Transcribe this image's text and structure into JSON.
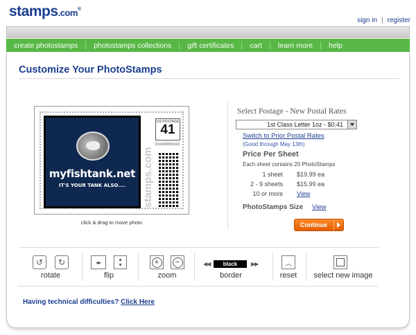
{
  "brand": {
    "name": "stamps",
    "suffix": ".com"
  },
  "top_links": {
    "sign_in": "sign in",
    "separator": "|",
    "register": "register"
  },
  "nav": {
    "items": [
      "create photostamps",
      "photostamps collections",
      "gift certificates",
      "cart",
      "learn more",
      "help"
    ]
  },
  "page": {
    "title": "Customize Your PhotoStamps"
  },
  "stamp_preview": {
    "photo_title": "myfishtank.net",
    "photo_subtitle": "IT'S YOUR TANK ALSO....",
    "postage_label": "US POSTAGE",
    "postage_value": "41",
    "serial": "1010000000103",
    "brand_vertical": "stamps.com",
    "caption": "click & drag to move photo"
  },
  "postage": {
    "heading": "Select Postage - New Postal Rates",
    "selected_rate": "1st Class Letter 1oz - $0.41",
    "prior_rates_link": "Switch to Prior Postal Rates",
    "good_through": "(Good through May 13th)",
    "price_heading": "Price Per Sheet",
    "sheet_note": "Each sheet contains 20 PhotoStamps",
    "prices": [
      {
        "qty": "1 sheet",
        "price": "$19.99 ea"
      },
      {
        "qty": "2 - 9 sheets",
        "price": "$15.99 ea"
      },
      {
        "qty": "10 or more",
        "price": "View"
      }
    ],
    "size_label": "PhotoStamps Size",
    "size_link": "View",
    "continue_label": "Continue"
  },
  "tools": {
    "rotate": "rotate",
    "flip": "flip",
    "zoom": "zoom",
    "border": "border",
    "border_color": "black",
    "reset": "reset",
    "select_new_image": "select new image"
  },
  "help": {
    "question": "Having technical difficulties?",
    "link": "Click Here"
  },
  "colors": {
    "brand_blue": "#1a3d8f",
    "nav_green": "#58b845",
    "continue_orange": "#f07010"
  }
}
